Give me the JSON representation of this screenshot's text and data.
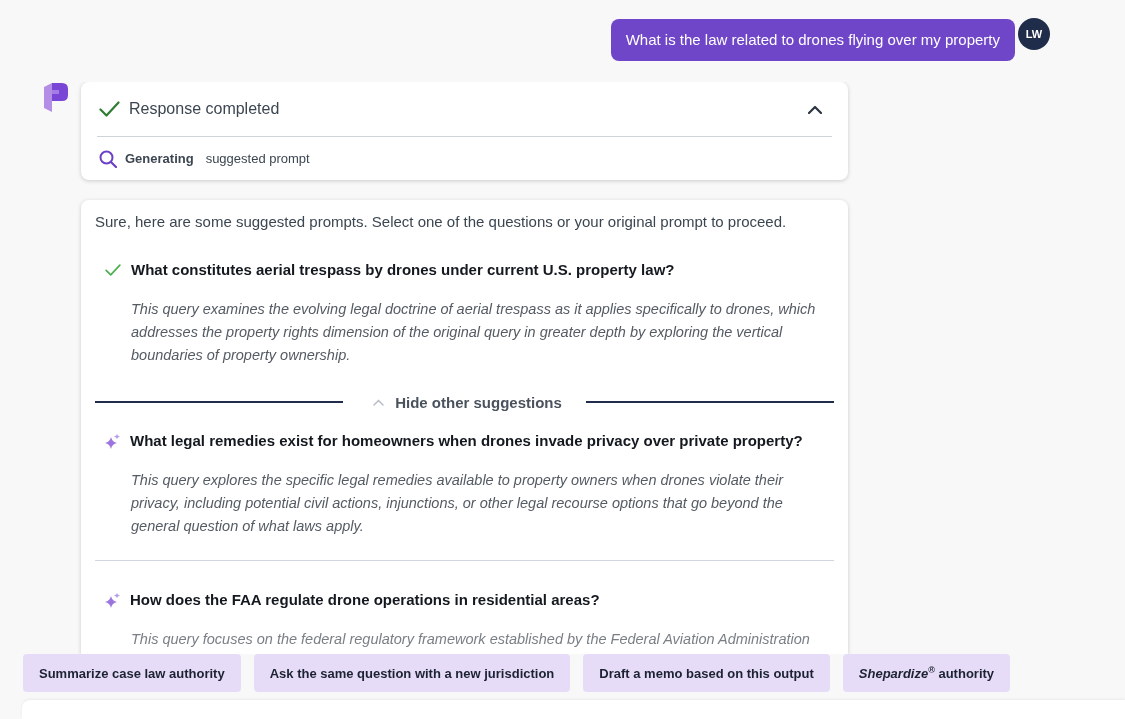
{
  "user_message": {
    "text": "What is the law related to drones flying over my property",
    "avatar_initials": "LW"
  },
  "status_card": {
    "title": "Response completed",
    "completed": true,
    "expanded": true,
    "activity": {
      "label": "Generating",
      "detail": "suggested prompt"
    }
  },
  "suggestions_card": {
    "intro": "Sure, here are some suggested prompts. Select one of the questions or your original prompt to proceed.",
    "suggestions": [
      {
        "title": "What constitutes aerial trespass by drones under current U.S. property law?",
        "description": "This query examines the evolving legal doctrine of aerial trespass as it applies specifically to drones, which addresses the property rights dimension of the original query in greater depth by exploring the vertical boundaries of property ownership.",
        "selected": true
      }
    ],
    "toggle": {
      "label": "Hide other suggestions",
      "expanded": true
    },
    "other_suggestions": [
      {
        "title": "What legal remedies exist for homeowners when drones invade privacy over private property?",
        "description": "This query explores the specific legal remedies available to property owners when drones violate their privacy, including potential civil actions, injunctions, or other legal recourse options that go beyond the general question of what laws apply.",
        "selected": false
      },
      {
        "title": "How does the FAA regulate drone operations in residential areas?",
        "description": "This query focuses on the federal regulatory framework established by the Federal Aviation Administration",
        "selected": false
      }
    ]
  },
  "actions": [
    {
      "label": "Summarize case law authority"
    },
    {
      "label": "Ask the same question with a new jurisdiction"
    },
    {
      "label": "Draft a memo based on this output"
    },
    {
      "label": "*Shepardize*$^{®}$ authority"
    }
  ]
}
